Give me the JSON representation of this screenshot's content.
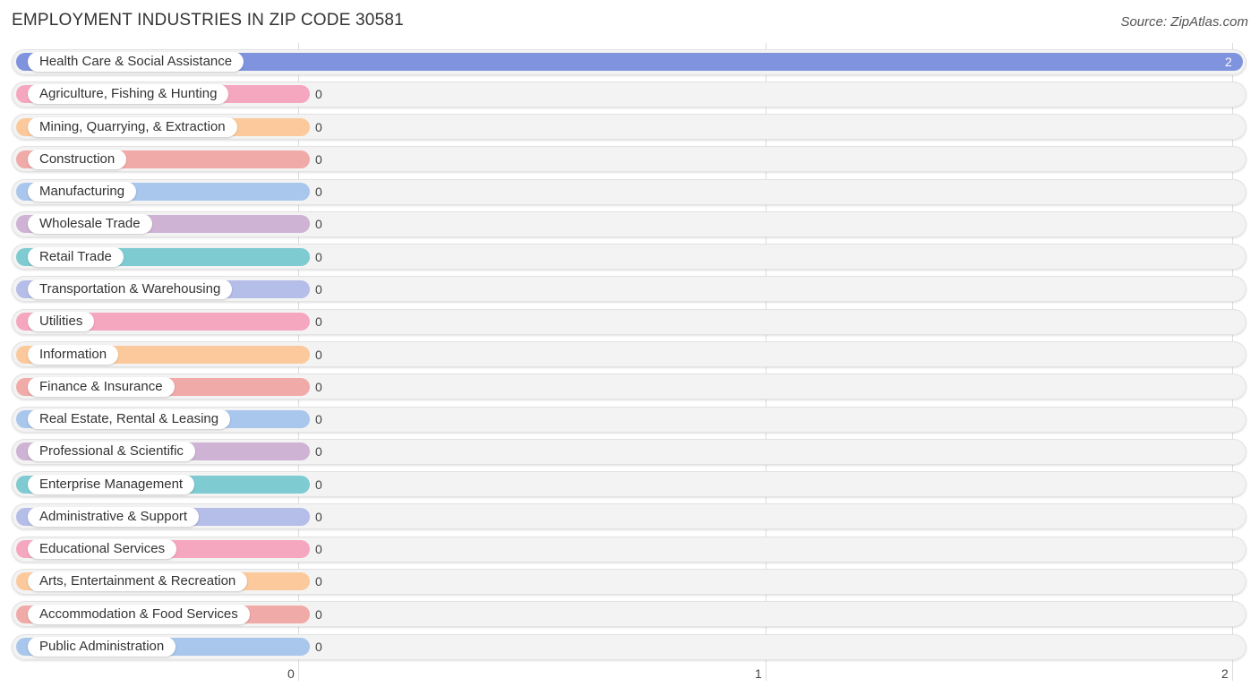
{
  "header": {
    "title": "EMPLOYMENT INDUSTRIES IN ZIP CODE 30581",
    "source": "Source: ZipAtlas.com"
  },
  "chart_data": {
    "type": "bar",
    "orientation": "horizontal",
    "title": "EMPLOYMENT INDUSTRIES IN ZIP CODE 30581",
    "source": "Source: ZipAtlas.com",
    "xlabel": "",
    "ylabel": "",
    "xlim": [
      0,
      2
    ],
    "x_ticks": [
      "0",
      "1",
      "2"
    ],
    "grid": true,
    "categories": [
      "Health Care & Social Assistance",
      "Agriculture, Fishing & Hunting",
      "Mining, Quarrying, & Extraction",
      "Construction",
      "Manufacturing",
      "Wholesale Trade",
      "Retail Trade",
      "Transportation & Warehousing",
      "Utilities",
      "Information",
      "Finance & Insurance",
      "Real Estate, Rental & Leasing",
      "Professional & Scientific",
      "Enterprise Management",
      "Administrative & Support",
      "Educational Services",
      "Arts, Entertainment & Recreation",
      "Accommodation & Food Services",
      "Public Administration"
    ],
    "values": [
      2,
      0,
      0,
      0,
      0,
      0,
      0,
      0,
      0,
      0,
      0,
      0,
      0,
      0,
      0,
      0,
      0,
      0,
      0
    ],
    "value_labels": [
      "2",
      "0",
      "0",
      "0",
      "0",
      "0",
      "0",
      "0",
      "0",
      "0",
      "0",
      "0",
      "0",
      "0",
      "0",
      "0",
      "0",
      "0",
      "0"
    ],
    "colors": [
      "#7f93de",
      "#f6a7c0",
      "#fbc99c",
      "#f0aaa8",
      "#a9c6ec",
      "#ceb3d5",
      "#7ecbd1",
      "#b5bde9",
      "#f6a7c0",
      "#fbc99c",
      "#f0aaa8",
      "#a9c6ec",
      "#ceb3d5",
      "#7ecbd1",
      "#b5bde9",
      "#f6a7c0",
      "#fbc99c",
      "#f0aaa8",
      "#a9c6ec"
    ]
  }
}
